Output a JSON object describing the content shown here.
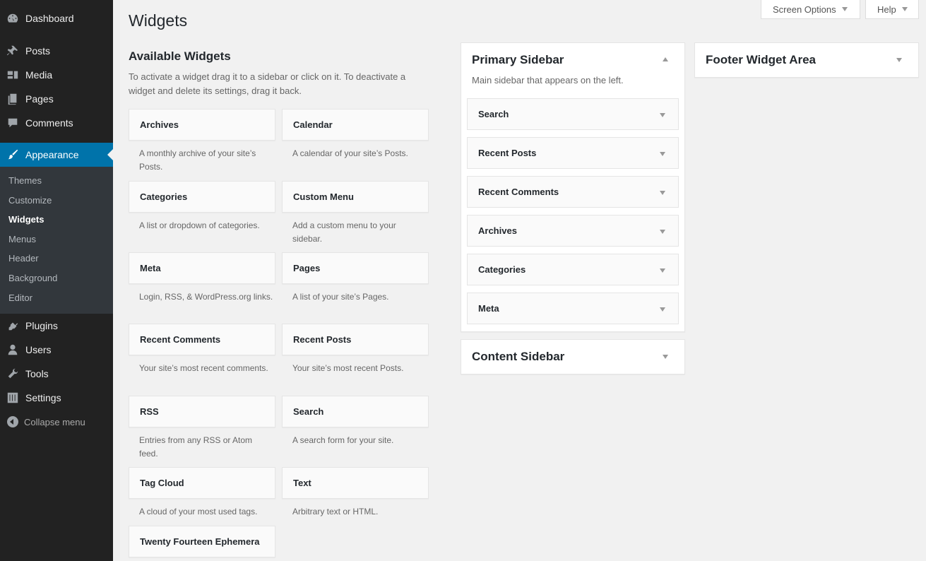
{
  "menu": {
    "dashboard": "Dashboard",
    "posts": "Posts",
    "media": "Media",
    "pages": "Pages",
    "comments": "Comments",
    "appearance": "Appearance",
    "plugins": "Plugins",
    "users": "Users",
    "tools": "Tools",
    "settings": "Settings",
    "collapse": "Collapse menu"
  },
  "submenu": [
    "Themes",
    "Customize",
    "Widgets",
    "Menus",
    "Header",
    "Background",
    "Editor"
  ],
  "top": {
    "screen_options": "Screen Options",
    "help": "Help"
  },
  "page_title": "Widgets",
  "available": {
    "title": "Available Widgets",
    "description": "To activate a widget drag it to a sidebar or click on it. To deactivate a widget and delete its settings, drag it back."
  },
  "widgets": [
    {
      "name": "Archives",
      "desc": "A monthly archive of your site’s Posts."
    },
    {
      "name": "Calendar",
      "desc": "A calendar of your site’s Posts."
    },
    {
      "name": "Categories",
      "desc": "A list or dropdown of categories."
    },
    {
      "name": "Custom Menu",
      "desc": "Add a custom menu to your sidebar."
    },
    {
      "name": "Meta",
      "desc": "Login, RSS, & WordPress.org links."
    },
    {
      "name": "Pages",
      "desc": "A list of your site’s Pages."
    },
    {
      "name": "Recent Comments",
      "desc": "Your site’s most recent comments."
    },
    {
      "name": "Recent Posts",
      "desc": "Your site’s most recent Posts."
    },
    {
      "name": "RSS",
      "desc": "Entries from any RSS or Atom feed."
    },
    {
      "name": "Search",
      "desc": "A search form for your site."
    },
    {
      "name": "Tag Cloud",
      "desc": "A cloud of your most used tags."
    },
    {
      "name": "Text",
      "desc": "Arbitrary text or HTML."
    },
    {
      "name": "Twenty Fourteen Ephemera",
      "desc": ""
    }
  ],
  "primary_sidebar": {
    "title": "Primary Sidebar",
    "description": "Main sidebar that appears on the left.",
    "widgets": [
      "Search",
      "Recent Posts",
      "Recent Comments",
      "Archives",
      "Categories",
      "Meta"
    ]
  },
  "content_sidebar": {
    "title": "Content Sidebar"
  },
  "footer_area": {
    "title": "Footer Widget Area"
  },
  "colors": {
    "menu_bg": "#222222",
    "submenu_bg": "#32373c",
    "accent": "#0073aa",
    "page_bg": "#f1f1f1"
  }
}
